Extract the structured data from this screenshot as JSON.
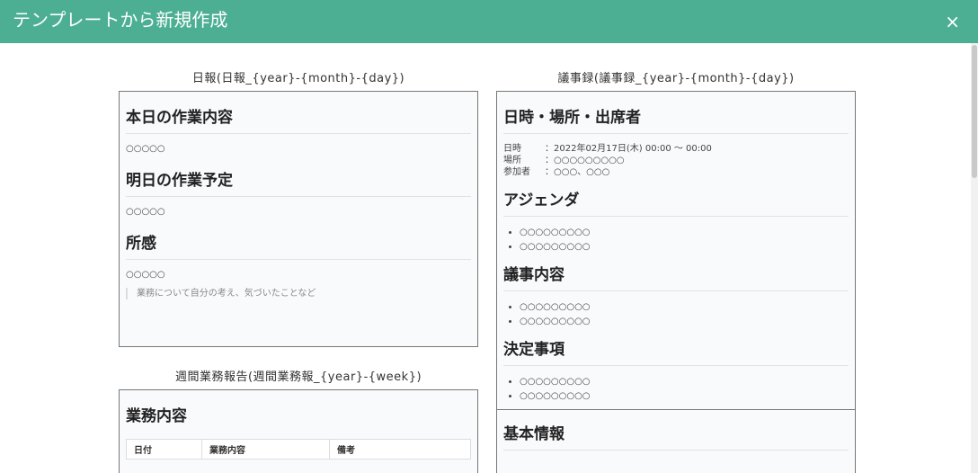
{
  "header": {
    "title": "テンプレートから新規作成",
    "close_label": "×"
  },
  "templates": {
    "daily": {
      "label": "日報(日報_{year}-{month}-{day})",
      "sections": [
        {
          "heading": "本日の作業内容",
          "body": "○○○○○"
        },
        {
          "heading": "明日の作業予定",
          "body": "○○○○○"
        },
        {
          "heading": "所感",
          "body": "○○○○○"
        }
      ],
      "quote": "業務について自分の考え、気づいたことなど"
    },
    "minutes": {
      "label": "議事録(議事録_{year}-{month}-{day})",
      "s1_heading": "日時・場所・出席者",
      "meta": [
        {
          "key": "日時",
          "value": "：2022年02月17日(木) 00:00 ～ 00:00"
        },
        {
          "key": "場所",
          "value": "：○○○○○○○○○"
        },
        {
          "key": "参加者",
          "value": "：○○○、○○○"
        }
      ],
      "agenda_heading": "アジェンダ",
      "agenda_items": [
        "○○○○○○○○○",
        "○○○○○○○○○"
      ],
      "content_heading": "議事内容",
      "content_items": [
        "○○○○○○○○○",
        "○○○○○○○○○"
      ],
      "decision_heading": "決定事項",
      "decision_items": [
        "○○○○○○○○○",
        "○○○○○○○○○"
      ]
    },
    "weekly": {
      "label": "週間業務報告(週間業務報_{year}-{week})",
      "heading": "業務内容",
      "columns": [
        "日付",
        "業務内容",
        "備考"
      ]
    },
    "basic": {
      "heading": "基本情報"
    }
  }
}
